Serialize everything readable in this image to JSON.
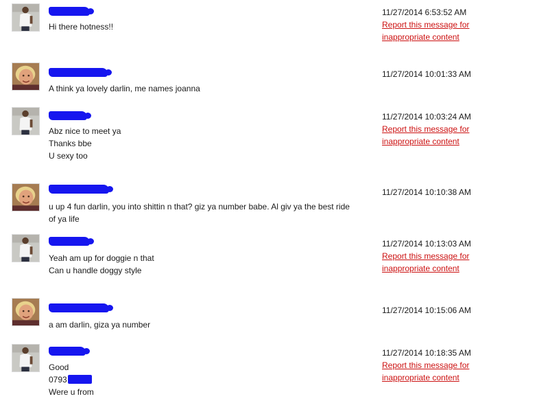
{
  "report_link_label": "Report this message for inappropriate content",
  "colors": {
    "redaction": "#1616ef",
    "report_link": "#cc1111",
    "text": "#1a1a1a"
  },
  "messages": [
    {
      "sender": "man-in-white-tshirt",
      "avatar": "man-white-shirt-avatar",
      "name_redacted": true,
      "lines": [
        "Hi there hotness!!"
      ],
      "timestamp": "11/27/2014 6:53:52 AM",
      "has_report_link": true
    },
    {
      "sender": "woman-joanna",
      "avatar": "blonde-woman-avatar",
      "name_redacted": true,
      "lines": [
        "A think ya lovely darlin, me names joanna"
      ],
      "timestamp": "11/27/2014 10:01:33 AM",
      "has_report_link": false
    },
    {
      "sender": "man-in-white-tshirt",
      "avatar": "man-white-shirt-avatar",
      "name_redacted": true,
      "lines": [
        "Abz nice to meet ya",
        "Thanks bbe",
        "U sexy too"
      ],
      "timestamp": "11/27/2014 10:03:24 AM",
      "has_report_link": true
    },
    {
      "sender": "woman-joanna",
      "avatar": "blonde-woman-avatar",
      "name_redacted": true,
      "lines": [
        "u up 4 fun darlin, you into shittin n that? giz ya number babe. Al giv ya the best ride of ya life"
      ],
      "timestamp": "11/27/2014 10:10:38 AM",
      "has_report_link": false
    },
    {
      "sender": "man-in-white-tshirt",
      "avatar": "man-white-shirt-avatar",
      "name_redacted": true,
      "lines": [
        "Yeah am up for doggie n that",
        "Can u handle doggy style"
      ],
      "timestamp": "11/27/2014 10:13:03 AM",
      "has_report_link": true
    },
    {
      "sender": "woman-joanna",
      "avatar": "blonde-woman-avatar",
      "name_redacted": true,
      "lines": [
        "a am darlin, giza ya number"
      ],
      "timestamp": "11/27/2014 10:15:06 AM",
      "has_report_link": false
    },
    {
      "sender": "man-in-white-tshirt",
      "avatar": "man-white-shirt-avatar",
      "name_redacted": true,
      "lines": [
        "Good",
        "0793",
        "Were u from"
      ],
      "redacted_number_suffix": true,
      "timestamp": "11/27/2014 10:18:35 AM",
      "has_report_link": true
    }
  ]
}
